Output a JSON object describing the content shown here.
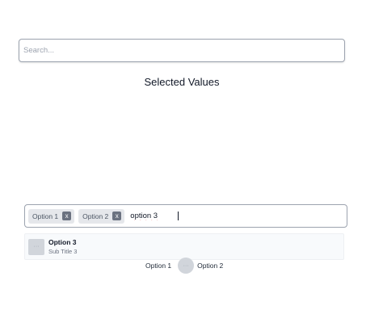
{
  "search": {
    "placeholder": "Search..."
  },
  "selected_section": {
    "title": "Selected Values"
  },
  "multiselect": {
    "chips": [
      {
        "label": "Option 1",
        "remove_label": "x"
      },
      {
        "label": "Option 2",
        "remove_label": "x"
      }
    ],
    "input_value": "option 3"
  },
  "dropdown": {
    "items": [
      {
        "title": "Option 3",
        "subtitle": "Sub Title 3",
        "thumb_glyph": "···"
      }
    ]
  },
  "selected_values": {
    "items": [
      {
        "label": "Option 1"
      },
      {
        "label": "Option 2",
        "thumb_glyph": "···"
      }
    ]
  },
  "colors": {
    "chip_bg": "#e5e7eb",
    "chip_remove_bg": "#6b7280",
    "border": "#9ca3af",
    "dropdown_bg": "#f8fafc",
    "thumb": "#d1d5db"
  },
  "icons": {
    "chip_remove": "close-icon",
    "placeholder_image": "image-placeholder-icon"
  }
}
